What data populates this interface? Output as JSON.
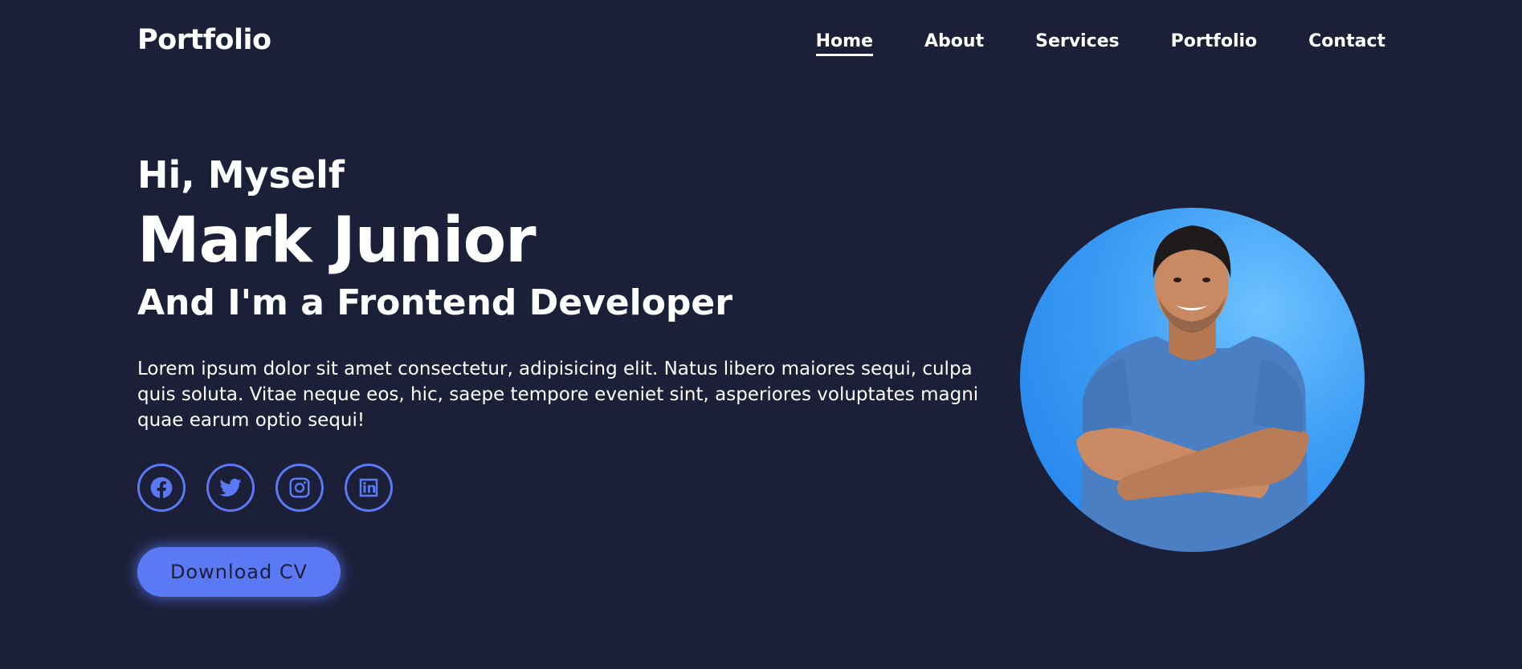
{
  "header": {
    "logo": "Portfolio",
    "nav": [
      {
        "label": "Home",
        "active": true
      },
      {
        "label": "About",
        "active": false
      },
      {
        "label": "Services",
        "active": false
      },
      {
        "label": "Portfolio",
        "active": false
      },
      {
        "label": "Contact",
        "active": false
      }
    ]
  },
  "hero": {
    "greeting": "Hi, Myself",
    "name": "Mark Junior",
    "role": "And I'm a Frontend Developer",
    "description": "Lorem ipsum dolor sit amet consectetur, adipisicing elit. Natus libero maiores sequi, culpa quis soluta. Vitae neque eos, hic, saepe tempore eveniet sint, asperiores voluptates magni quae earum optio sequi!",
    "socials": [
      {
        "icon": "facebook-icon"
      },
      {
        "icon": "twitter-icon"
      },
      {
        "icon": "instagram-icon"
      },
      {
        "icon": "linkedin-icon"
      }
    ],
    "cta_label": "Download CV"
  },
  "colors": {
    "background": "#1b1f38",
    "accent": "#5b79f5",
    "text": "#ffffff",
    "portrait_bg": "#3b9cf5",
    "shirt": "#4a7fc4",
    "skin": "#c98a63"
  }
}
